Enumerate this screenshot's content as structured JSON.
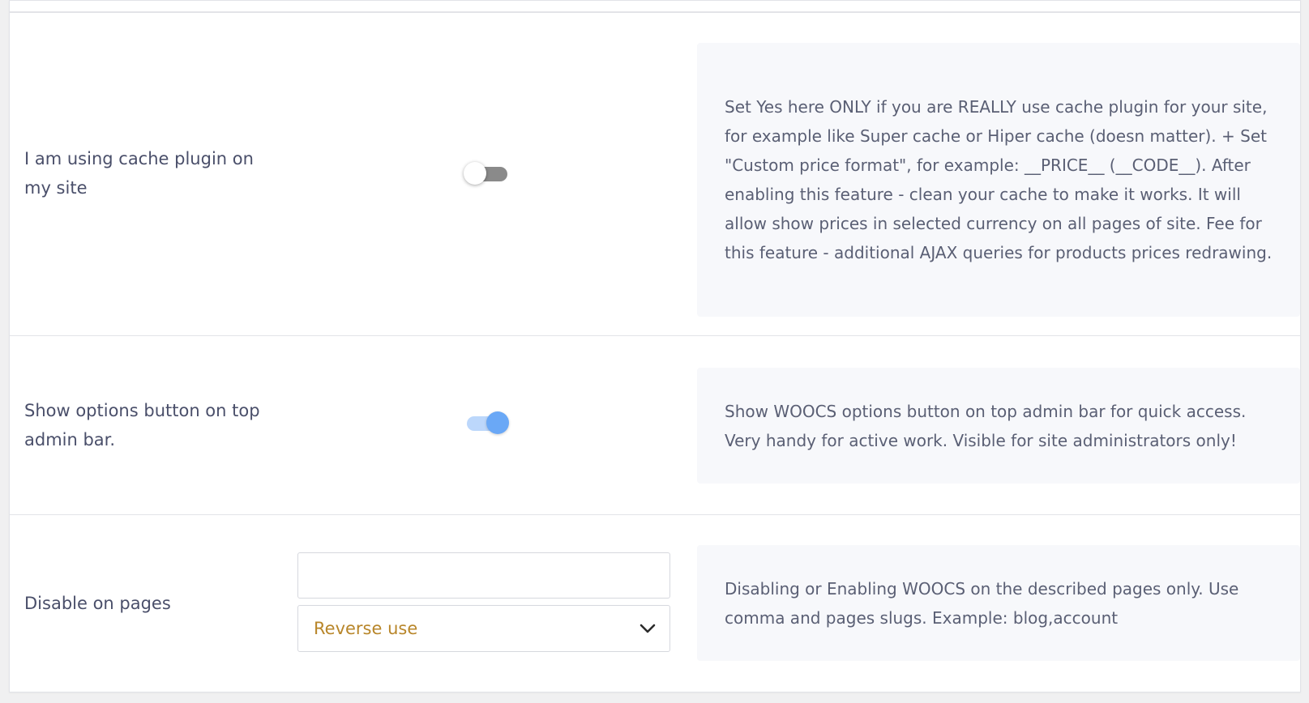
{
  "settings": {
    "cache_plugin": {
      "label": "I am using cache plugin on my site",
      "enabled": false,
      "description": "Set Yes here ONLY if you are REALLY use cache plugin for your site, for example like Super cache or Hiper cache (doesn matter). + Set \"Custom price format\", for example: __PRICE__ (__CODE__). After enabling this feature - clean your cache to make it works. It will allow show prices in selected currency on all pages of site. Fee for this feature - additional AJAX queries for products prices redrawing."
    },
    "admin_bar_button": {
      "label": "Show options button on top admin bar.",
      "enabled": true,
      "description": "Show WOOCS options button on top admin bar for quick access. Very handy for active work. Visible for site administrators only!"
    },
    "disable_on_pages": {
      "label": "Disable on pages",
      "input_value": "",
      "input_placeholder": "",
      "select_value": "Reverse use",
      "description": "Disabling or Enabling WOOCS on the described pages only. Use comma and pages slugs. Example: blog,account"
    }
  },
  "colors": {
    "toggle_on": "#6aa8f6",
    "toggle_off": "#8a8a8a",
    "select_text": "#b8862a",
    "description_bg": "#f7f8fb"
  },
  "icons": {
    "select_arrow": "chevron-down-icon"
  }
}
